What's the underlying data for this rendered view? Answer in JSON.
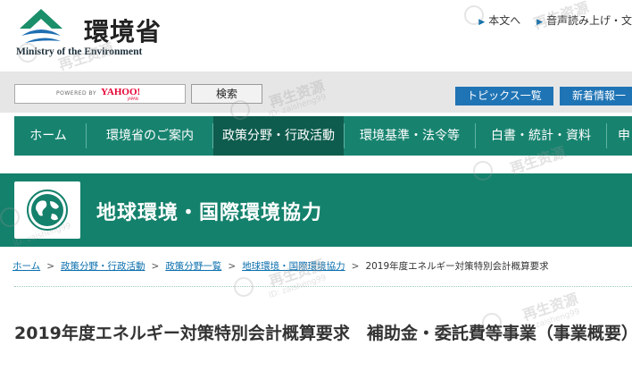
{
  "header": {
    "logo_jp": "環境省",
    "logo_en": "Ministry of the Environment",
    "util_links": [
      {
        "label": "本文へ"
      },
      {
        "label": "音声読み上げ・文"
      }
    ]
  },
  "search": {
    "powered_by": "POWERED BY",
    "yahoo_label": "YAHOO!",
    "yahoo_sub": "JAPAN",
    "button_label": "検索",
    "topics_label": "トピックス一覧",
    "news_label": "新着情報一"
  },
  "nav": {
    "items": [
      {
        "label": "ホーム"
      },
      {
        "label": "環境省のご案内"
      },
      {
        "label": "政策分野・行政活動"
      },
      {
        "label": "環境基準・法令等"
      },
      {
        "label": "白書・統計・資料"
      },
      {
        "label": "申"
      }
    ]
  },
  "band": {
    "title": "地球環境・国際環境協力"
  },
  "breadcrumb": {
    "links": [
      {
        "label": "ホーム"
      },
      {
        "label": "政策分野・行政活動"
      },
      {
        "label": "政策分野一覧"
      },
      {
        "label": "地球環境・国際環境協力"
      }
    ],
    "current": "2019年度エネルギー対策特別会計概算要求",
    "separator": ">"
  },
  "page": {
    "title": "2019年度エネルギー対策特別会計概算要求　補助金・委託費等事業（事業概要）"
  },
  "watermark": {
    "text": "再生资源",
    "sub": "ID: zaisheng99"
  },
  "colors": {
    "nav_green": "#17836f",
    "band_green": "#14816c",
    "button_blue": "#1f74b5",
    "link_blue": "#0b6fae"
  }
}
